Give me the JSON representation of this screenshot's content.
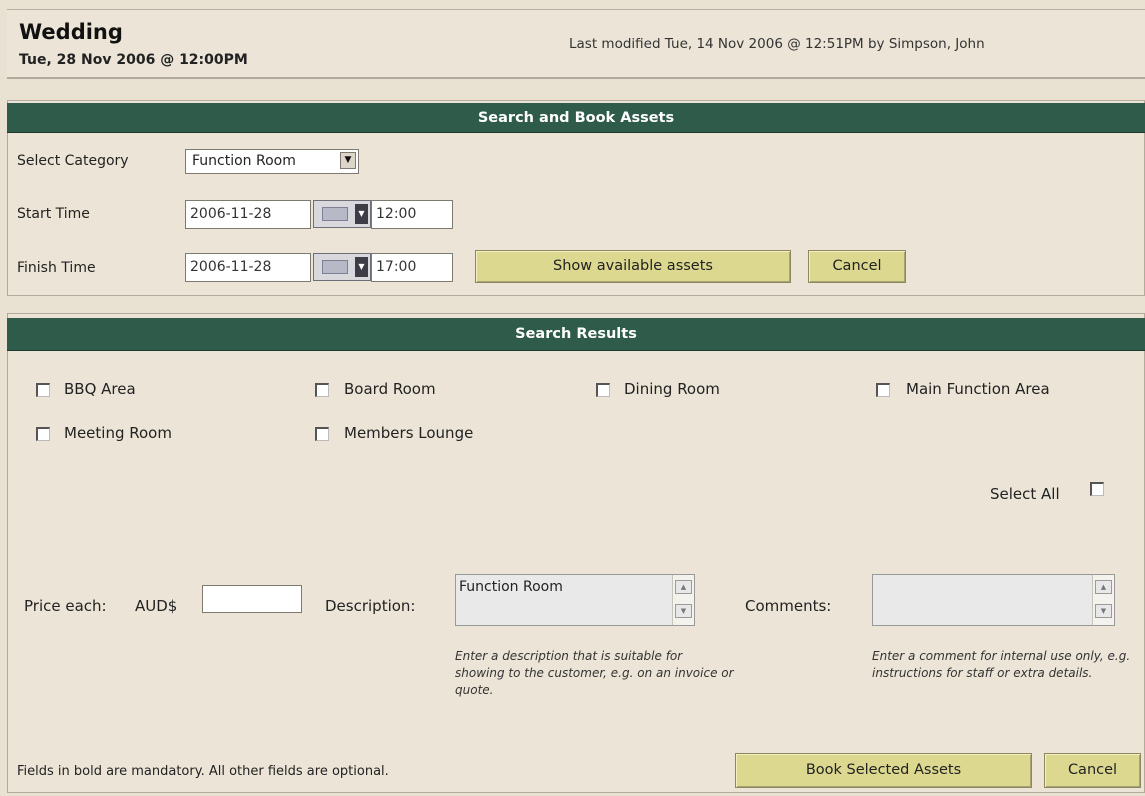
{
  "header": {
    "title": "Wedding",
    "datetime": "Tue, 28 Nov 2006 @ 12:00PM",
    "last_modified": "Last modified Tue, 14 Nov 2006 @ 12:51PM by Simpson, John"
  },
  "search": {
    "heading": "Search and Book Assets",
    "category_label": "Select Category",
    "category_value": "Function Room",
    "start_label": "Start Time",
    "start_date": "2006-11-28",
    "start_time": "12:00",
    "finish_label": "Finish Time",
    "finish_date": "2006-11-28",
    "finish_time": "17:00",
    "show_button": "Show available assets",
    "cancel_button": "Cancel"
  },
  "results": {
    "heading": "Search Results",
    "assets": [
      {
        "label": "BBQ Area",
        "checked": false
      },
      {
        "label": "Board Room",
        "checked": false
      },
      {
        "label": "Dining Room",
        "checked": false
      },
      {
        "label": "Main Function Area",
        "checked": false
      },
      {
        "label": "Meeting Room",
        "checked": false
      },
      {
        "label": "Members Lounge",
        "checked": false
      }
    ],
    "select_all_label": "Select All",
    "price_label": "Price each:",
    "currency": "AUD$",
    "price_value": "",
    "description_label": "Description:",
    "description_value": "Function Room",
    "description_help": "Enter a description that is suitable for showing to the customer, e.g. on an invoice or quote.",
    "comments_label": "Comments:",
    "comments_value": "",
    "comments_help": "Enter a comment for internal use only, e.g. instructions for staff or extra details.",
    "mandatory_note": "Fields in bold are mandatory. All other fields are optional.",
    "book_button": "Book Selected Assets",
    "cancel_button": "Cancel"
  }
}
